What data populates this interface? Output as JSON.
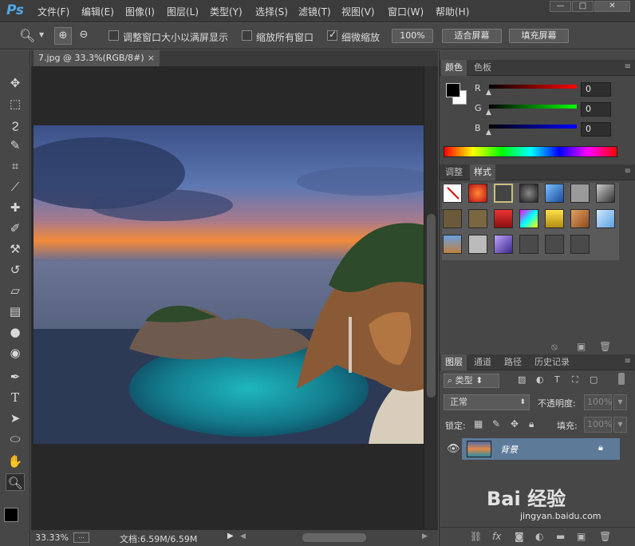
{
  "app": {
    "logo": "Ps"
  },
  "menu": [
    "文件(F)",
    "编辑(E)",
    "图像(I)",
    "图层(L)",
    "类型(Y)",
    "选择(S)",
    "滤镜(T)",
    "视图(V)",
    "窗口(W)",
    "帮助(H)"
  ],
  "window_controls": {
    "minimize": "—",
    "maximize": "□",
    "close": "✕"
  },
  "options_bar": {
    "resize_windows_label": "调整窗口大小以满屏显示",
    "resize_windows_checked": false,
    "zoom_all_label": "缩放所有窗口",
    "zoom_all_checked": false,
    "scrubby_zoom_label": "细微缩放",
    "scrubby_zoom_checked": true,
    "btn_100": "100%",
    "btn_fit": "适合屏幕",
    "btn_fill": "填充屏幕"
  },
  "document": {
    "tab_title": "7.jpg @ 33.3%(RGB/8#)",
    "close": "×"
  },
  "status": {
    "zoom": "33.33%",
    "doc_info": "文档:6.59M/6.59M"
  },
  "color_panel": {
    "tabs": [
      "颜色",
      "色板"
    ],
    "channels": [
      {
        "label": "R",
        "value": "0"
      },
      {
        "label": "G",
        "value": "0"
      },
      {
        "label": "B",
        "value": "0"
      }
    ],
    "foreground": "#000000",
    "background": "#ffffff"
  },
  "styles_panel": {
    "tabs": [
      "调整",
      "样式"
    ]
  },
  "layers_panel": {
    "tabs": [
      "图层",
      "通道",
      "路径",
      "历史记录"
    ],
    "filter_label": "类型",
    "blend_mode": "正常",
    "opacity_label": "不透明度:",
    "opacity_value": "100%",
    "lock_label": "锁定:",
    "fill_label": "填充:",
    "fill_value": "100%",
    "layer_name": "背景"
  },
  "watermark": {
    "brand": "Bai 经验",
    "url": "jingyan.baidu.com"
  }
}
